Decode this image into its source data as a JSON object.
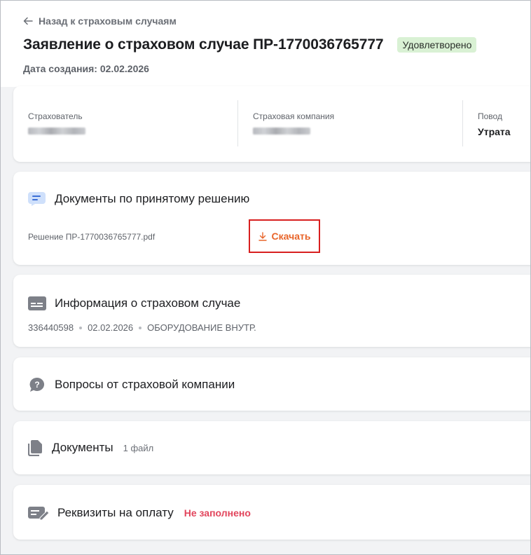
{
  "header": {
    "back_label": "Назад к страховым случаям",
    "title": "Заявление о страховом случае ПР-1770036765777",
    "status": "Удовлетворено",
    "created": "Дата создания: 02.02.2026"
  },
  "parties": {
    "insurer_label": "Страхователь",
    "company_label": "Страховая компания",
    "reason_label": "Повод",
    "reason_value": "Утрата"
  },
  "decision_docs": {
    "title": "Документы по принятому решению",
    "file_name": "Решение ПР-1770036765777.pdf",
    "download_label": "Скачать"
  },
  "case_info": {
    "title": "Информация о страховом случае",
    "number": "336440598",
    "date": "02.02.2026",
    "object": "ОБОРУДОВАНИЕ ВНУТР."
  },
  "questions": {
    "title": "Вопросы от страховой компании"
  },
  "documents": {
    "title": "Документы",
    "count": "1 файл"
  },
  "payment": {
    "title": "Реквизиты на оплату",
    "status": "Не заполнено"
  },
  "colors": {
    "accent_orange": "#e8652a",
    "status_green_bg": "#d9f1d4",
    "warning_red": "#e2455c",
    "highlight_red": "#d81f1f",
    "icon_blue": "#3d6fd6",
    "icon_grey": "#7d8088"
  },
  "icons": [
    "arrow-left-icon",
    "chat-doc-icon",
    "download-icon",
    "id-card-icon",
    "question-icon",
    "copy-docs-icon",
    "edit-card-icon"
  ]
}
